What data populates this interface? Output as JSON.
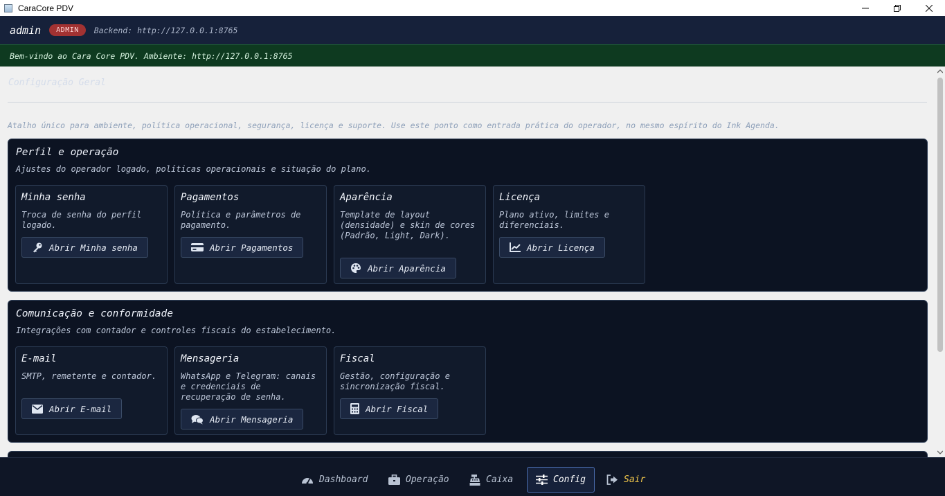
{
  "window": {
    "title": "CaraCore PDV"
  },
  "header": {
    "user": "admin",
    "role_badge": "ADMIN",
    "backend": "Backend: http://127.0.0.1:8765"
  },
  "notice": "Bem-vindo ao Cara Core PDV. Ambiente: http://127.0.0.1:8765",
  "page": {
    "title": "Configuração Geral",
    "intro": "Atalho único para ambiente, política operacional, segurança, licença e suporte. Use este ponto como entrada prática do operador, no mesmo espírito do Ink Agenda."
  },
  "sections": [
    {
      "title": "Perfil e operação",
      "desc": "Ajustes do operador logado, políticas operacionais e situação do plano.",
      "cards": [
        {
          "title": "Minha senha",
          "desc": "Troca de senha do perfil logado.",
          "button": "Abrir Minha senha",
          "icon": "key-icon"
        },
        {
          "title": "Pagamentos",
          "desc": "Política e parâmetros de pagamento.",
          "button": "Abrir Pagamentos",
          "icon": "credit-card-icon"
        },
        {
          "title": "Aparência",
          "desc": "Template de layout (densidade) e skin de cores (Padrão, Light, Dark).",
          "button": "Abrir Aparência",
          "icon": "palette-icon"
        },
        {
          "title": "Licença",
          "desc": "Plano ativo, limites e diferenciais.",
          "button": "Abrir Licença",
          "icon": "chart-line-icon"
        }
      ]
    },
    {
      "title": "Comunicação e conformidade",
      "desc": "Integrações com contador e controles fiscais do estabelecimento.",
      "cards": [
        {
          "title": "E-mail",
          "desc": "SMTP, remetente e contador.",
          "button": "Abrir E-mail",
          "icon": "envelope-icon"
        },
        {
          "title": "Mensageria",
          "desc": "WhatsApp e Telegram: canais e credenciais de recuperação de senha.",
          "button": "Abrir Mensageria",
          "icon": "comments-icon"
        },
        {
          "title": "Fiscal",
          "desc": "Gestão, configuração e sincronização fiscal.",
          "button": "Abrir Fiscal",
          "icon": "calculator-icon"
        }
      ]
    }
  ],
  "nav": [
    {
      "label": "Dashboard",
      "icon": "gauge-icon",
      "active": false
    },
    {
      "label": "Operação",
      "icon": "briefcase-icon",
      "active": false
    },
    {
      "label": "Caixa",
      "icon": "cash-register-icon",
      "active": false
    },
    {
      "label": "Config",
      "icon": "sliders-icon",
      "active": true
    },
    {
      "label": "Sair",
      "icon": "sign-out-icon",
      "active": false
    }
  ],
  "colors": {
    "header_bg": "#16213a",
    "notice_bg": "#0e3a20",
    "panel_bg": "#0c1322",
    "badge": "#a23232",
    "exit": "#f2c84b",
    "active_border": "#4a6cae"
  }
}
